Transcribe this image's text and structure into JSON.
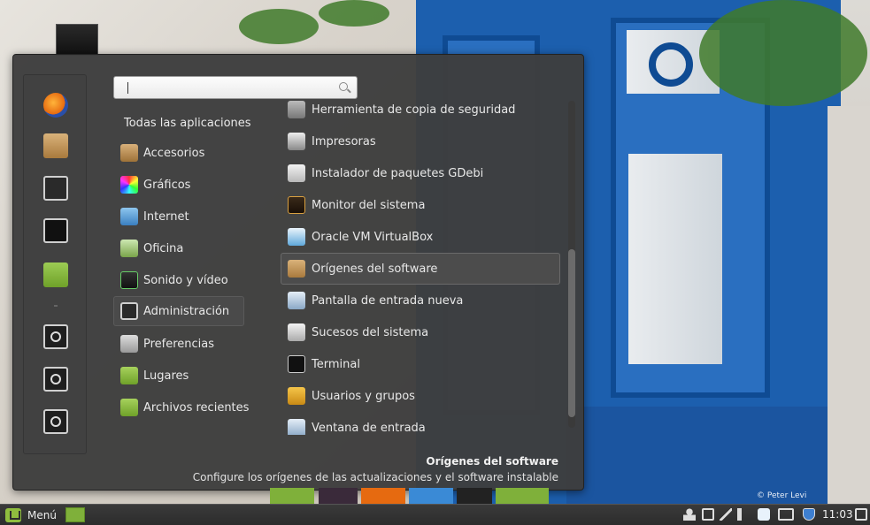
{
  "menu": {
    "search": {
      "value": "",
      "placeholder": ""
    },
    "all_apps_label": "Todas las aplicaciones",
    "categories": [
      {
        "label": "Accesorios",
        "icon": "accessories-icon"
      },
      {
        "label": "Gráficos",
        "icon": "graphics-icon"
      },
      {
        "label": "Internet",
        "icon": "internet-icon"
      },
      {
        "label": "Oficina",
        "icon": "office-icon"
      },
      {
        "label": "Sonido y vídeo",
        "icon": "sound-video-icon"
      },
      {
        "label": "Administración",
        "icon": "administration-icon",
        "selected": true
      },
      {
        "label": "Preferencias",
        "icon": "preferences-icon"
      },
      {
        "label": "Lugares",
        "icon": "folder-icon"
      },
      {
        "label": "Archivos recientes",
        "icon": "recent-files-icon"
      }
    ],
    "apps": [
      {
        "label": "Herramienta de copia de seguridad",
        "icon": "backup-icon"
      },
      {
        "label": "Impresoras",
        "icon": "printer-icon"
      },
      {
        "label": "Instalador de paquetes GDebi",
        "icon": "package-installer-icon"
      },
      {
        "label": "Monitor del sistema",
        "icon": "system-monitor-icon"
      },
      {
        "label": "Oracle VM VirtualBox",
        "icon": "virtualbox-icon"
      },
      {
        "label": "Orígenes del software",
        "icon": "software-sources-icon",
        "selected": true
      },
      {
        "label": "Pantalla de entrada nueva",
        "icon": "login-screen-icon"
      },
      {
        "label": "Sucesos del sistema",
        "icon": "system-log-icon"
      },
      {
        "label": "Terminal",
        "icon": "terminal-icon"
      },
      {
        "label": "Usuarios y grupos",
        "icon": "users-groups-icon"
      },
      {
        "label": "Ventana de entrada",
        "icon": "login-window-icon"
      }
    ],
    "description": {
      "title": "Orígenes del software",
      "text": "Configure los orígenes de las actualizaciones y el software instalable"
    },
    "favorites": [
      "firefox-icon",
      "software-manager-icon",
      "settings-icon",
      "terminal-icon",
      "files-icon"
    ],
    "system_buttons": [
      "lock-screen-icon",
      "logout-icon",
      "shutdown-icon"
    ]
  },
  "panel": {
    "menu_label": "Menú",
    "clock": "11:03"
  },
  "wallpaper": {
    "credit": "© Peter Levi"
  }
}
